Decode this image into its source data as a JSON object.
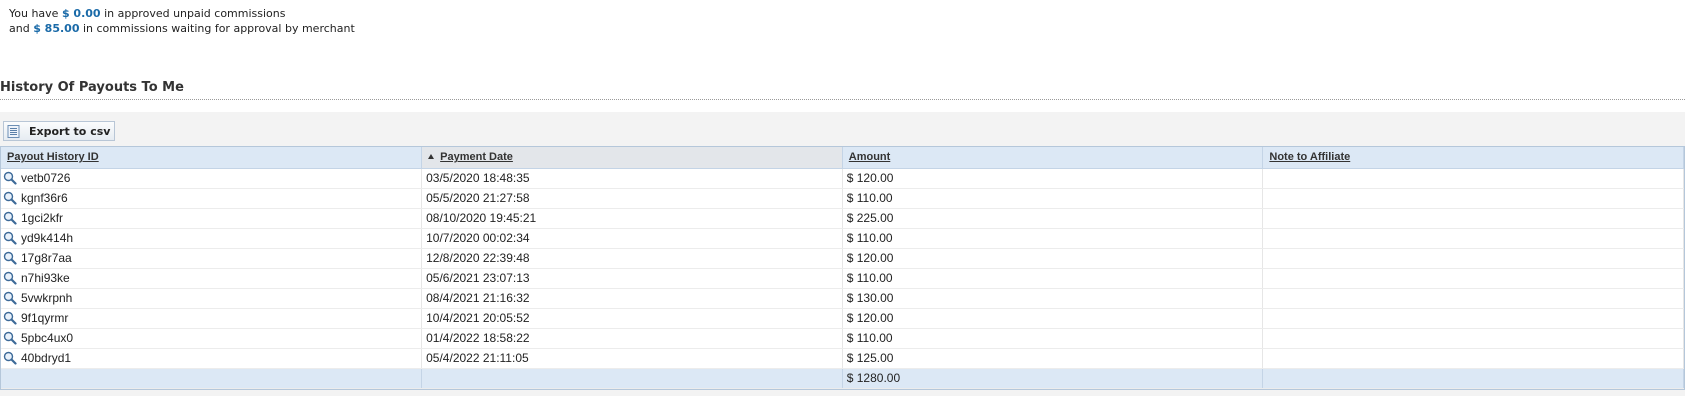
{
  "summary": {
    "line1_prefix": "You have",
    "approved_amount": "$ 0.00",
    "line1_suffix": "in approved unpaid commissions",
    "line2_prefix": "and",
    "pending_amount": "$ 85.00",
    "line2_suffix": "in commissions waiting for approval by merchant"
  },
  "section_title": "History Of Payouts To Me",
  "toolbar": {
    "export_label": "Export to csv",
    "export_icon": "csv-export-icon"
  },
  "table": {
    "columns": [
      {
        "label": "Payout History ID"
      },
      {
        "label": "Payment Date",
        "sorted": "ascending"
      },
      {
        "label": "Amount"
      },
      {
        "label": "Note to Affiliate"
      }
    ],
    "rows": [
      {
        "id": "vetb0726",
        "date": "03/5/2020 18:48:35",
        "amount": "$ 120.00",
        "note": ""
      },
      {
        "id": "kgnf36r6",
        "date": "05/5/2020 21:27:58",
        "amount": "$ 110.00",
        "note": ""
      },
      {
        "id": "1gci2kfr",
        "date": "08/10/2020 19:45:21",
        "amount": "$ 225.00",
        "note": ""
      },
      {
        "id": "yd9k414h",
        "date": "10/7/2020 00:02:34",
        "amount": "$ 110.00",
        "note": ""
      },
      {
        "id": "17g8r7aa",
        "date": "12/8/2020 22:39:48",
        "amount": "$ 120.00",
        "note": ""
      },
      {
        "id": "n7hi93ke",
        "date": "05/6/2021 23:07:13",
        "amount": "$ 110.00",
        "note": ""
      },
      {
        "id": "5vwkrpnh",
        "date": "08/4/2021 21:16:32",
        "amount": "$ 130.00",
        "note": ""
      },
      {
        "id": "9f1qyrmr",
        "date": "10/4/2021 20:05:52",
        "amount": "$ 120.00",
        "note": ""
      },
      {
        "id": "5pbc4ux0",
        "date": "01/4/2022 18:58:22",
        "amount": "$ 110.00",
        "note": ""
      },
      {
        "id": "40bdryd1",
        "date": "05/4/2022 21:11:05",
        "amount": "$ 125.00",
        "note": ""
      }
    ],
    "total": "$ 1280.00",
    "row_icon": "magnifier-icon"
  },
  "colors": {
    "accent_amount": "#1a6aa8",
    "header_bg": "#dce8f5",
    "sorted_header_bg": "#e3e6ea",
    "toolbar_bg": "#f3f3f3"
  }
}
